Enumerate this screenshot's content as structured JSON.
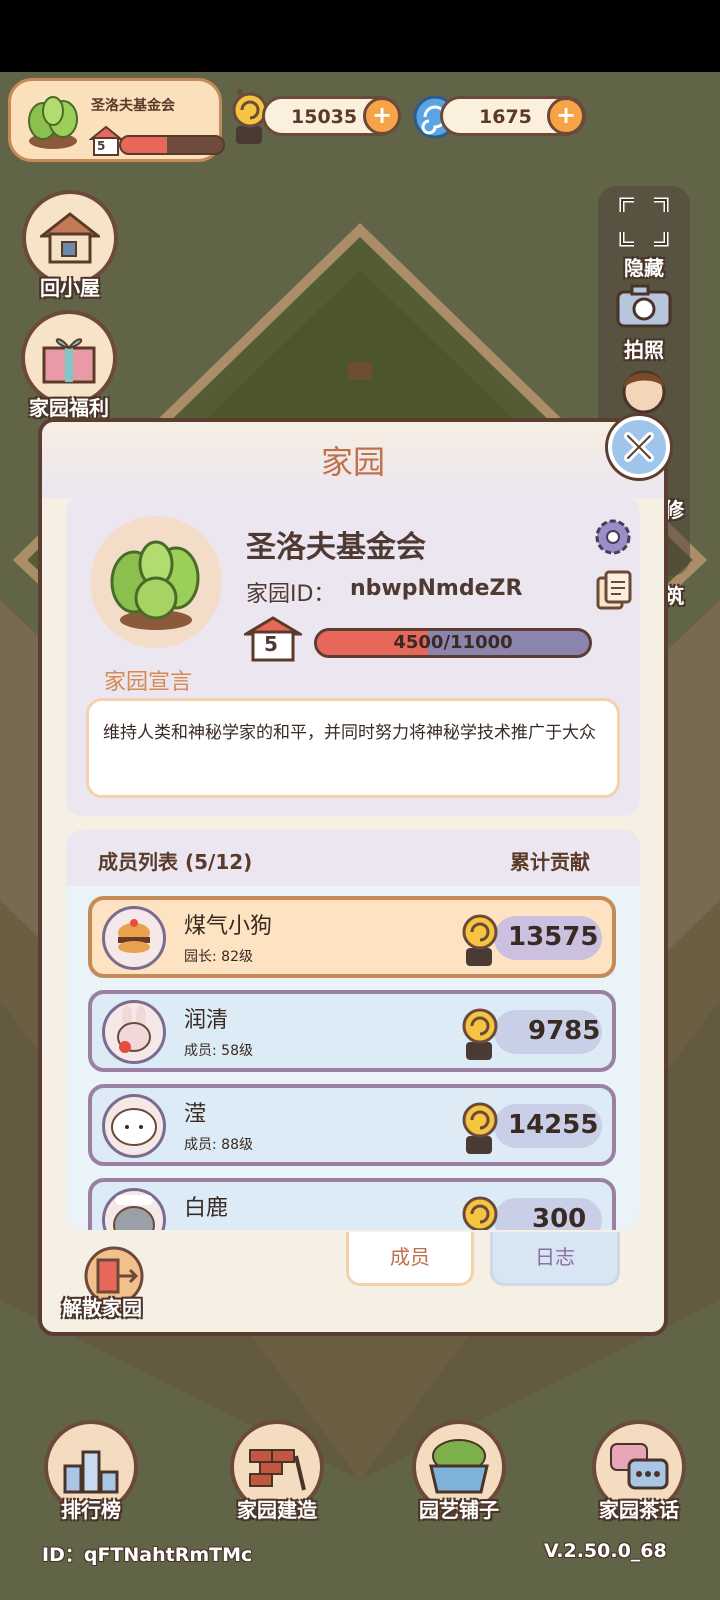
{
  "top_bar": {
    "garden_name": "圣洛夫基金会",
    "garden_level": "5",
    "garden_exp_progress": 0.45,
    "coins": "15035",
    "gems": "1675",
    "plus_symbol": "+"
  },
  "left_buttons": {
    "home": "回小屋",
    "welfare": "家园福利"
  },
  "right_panel": {
    "hide": "隐藏",
    "photo": "拍照",
    "partial_1": "修",
    "partial_2": "筑"
  },
  "modal": {
    "title": "家园",
    "garden_name": "圣洛夫基金会",
    "id_label": "家园ID：",
    "id_value": "nbwpNmdeZR",
    "level": "5",
    "exp_text": "4500/11000",
    "exp_progress": 0.409,
    "declaration_label": "家园宣言",
    "declaration_text": "维持人类和神秘学家的和平，并同时努力将神秘学技术推广于大众"
  },
  "members": {
    "header_left": "成员列表 (5/12)",
    "header_right": "累计贡献",
    "list": [
      {
        "name": "煤气小狗",
        "role": "园长: 82级",
        "value": "13575"
      },
      {
        "name": "润清",
        "role": "成员: 58级",
        "value": "9785"
      },
      {
        "name": "滢",
        "role": "成员: 88级",
        "value": "14255"
      },
      {
        "name": "白鹿",
        "role": "",
        "value": "300"
      }
    ]
  },
  "tabs": {
    "members": "成员",
    "log": "日志"
  },
  "dissolve": "解散家园",
  "bottom_nav": {
    "ranking": "排行榜",
    "build": "家园建造",
    "shop": "园艺铺子",
    "chat": "家园茶话"
  },
  "footer": {
    "id": "ID：qFTNahtRmTMc",
    "version": "V.2.50.0_68"
  },
  "colors": {
    "accent": "#c1714a",
    "exp_fill": "#e7685a",
    "panel_border": "#5b3e32"
  }
}
